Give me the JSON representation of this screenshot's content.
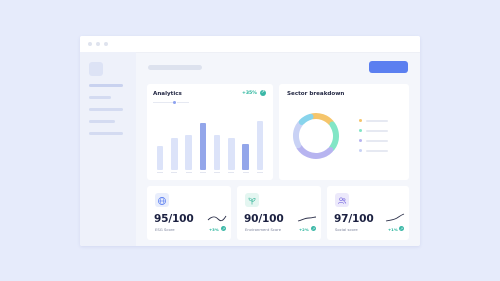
{
  "analytics": {
    "title": "Analytics",
    "change": "+35%",
    "change_icon": "arrow-up-right-icon",
    "bars": [
      {
        "value": 42,
        "highlighted": false
      },
      {
        "value": 58,
        "highlighted": false
      },
      {
        "value": 62,
        "highlighted": false
      },
      {
        "value": 84,
        "highlighted": true
      },
      {
        "value": 62,
        "highlighted": false
      },
      {
        "value": 58,
        "highlighted": false
      },
      {
        "value": 46,
        "highlighted": true
      },
      {
        "value": 88,
        "highlighted": false
      }
    ]
  },
  "sector": {
    "title": "Sector breakdown",
    "segments": [
      {
        "color": "#f5c56b",
        "value": 18
      },
      {
        "color": "#82e6c6",
        "value": 22
      },
      {
        "color": "#b7b4f0",
        "value": 30
      },
      {
        "color": "#c9d2f5",
        "value": 20
      },
      {
        "color": "#88d4ec",
        "value": 10
      }
    ]
  },
  "stats": [
    {
      "value": "95/100",
      "label": "ESG Score",
      "delta": "+3%",
      "icon": "globe-icon",
      "icon_bg": "#e9eefc",
      "icon_color": "#5b7ff0"
    },
    {
      "value": "90/100",
      "label": "Environment Score",
      "delta": "+2%",
      "icon": "leaf-icon",
      "icon_bg": "#e4f6f1",
      "icon_color": "#37b59a"
    },
    {
      "value": "97/100",
      "label": "Social score",
      "delta": "+1%",
      "icon": "people-icon",
      "icon_bg": "#ece9fb",
      "icon_color": "#7a6be0"
    }
  ]
}
